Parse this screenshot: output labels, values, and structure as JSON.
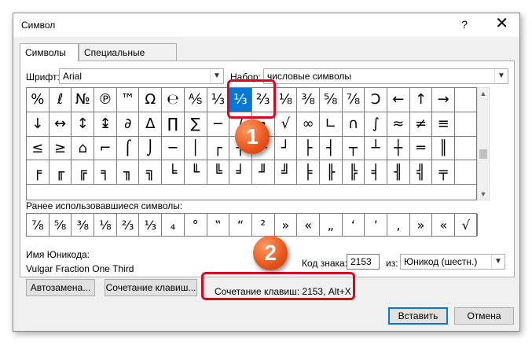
{
  "window": {
    "title": "Символ",
    "help": "?",
    "close": "✕"
  },
  "tabs": [
    {
      "label": "Символы",
      "active": true
    },
    {
      "label": "Специальные знаки",
      "active": false
    }
  ],
  "font": {
    "label": "Шрифт:",
    "value": "Arial"
  },
  "subset": {
    "label": "Набор:",
    "value": "числовые символы"
  },
  "grid": {
    "rows": [
      [
        "%",
        "ℓ",
        "№",
        "℗",
        "™",
        "Ω",
        "℮",
        "⅍",
        "⅓",
        "⅓",
        "⅔",
        "⅛",
        "⅜",
        "⅝",
        "⅞",
        "Ↄ",
        "←",
        "↑",
        "→",
        ""
      ],
      [
        "↓",
        "↔",
        "↕",
        "↨",
        "∂",
        "∆",
        "∏",
        "∑",
        "−",
        "∕",
        "∙",
        "√",
        "∞",
        "∟",
        "∩",
        "∫",
        "≈",
        "≠",
        "≡",
        ""
      ],
      [
        "≤",
        "≥",
        "⌂",
        "⌐",
        "⌠",
        "⌡",
        "─",
        "│",
        "┌",
        "┐",
        "└",
        "┘",
        "├",
        "┤",
        "┬",
        "┴",
        "┼",
        "═",
        "║",
        ""
      ],
      [
        "╒",
        "╓",
        "╔",
        "╕",
        "╖",
        "╗",
        "╘",
        "╙",
        "╚",
        "╛",
        "╜",
        "╝",
        "╞",
        "╟",
        "╠",
        "╡",
        "╢",
        "╣",
        "╤",
        ""
      ]
    ],
    "selected_row": 0,
    "selected_col": 9
  },
  "recent": {
    "label": "Ранее использовавшиеся символы:",
    "items": [
      "⅞",
      "⅝",
      "⅜",
      "⅛",
      "⅔",
      "⅓",
      "₄",
      "°",
      "‟",
      "“",
      "²",
      "»",
      "«",
      "„",
      "‘",
      "’",
      "‚",
      "»",
      "«",
      "√"
    ]
  },
  "unicode_name": {
    "label": "Имя Юникода:",
    "value": "Vulgar Fraction One Third"
  },
  "char_code": {
    "label": "Код знака:",
    "value": "2153"
  },
  "from": {
    "label": "из:",
    "value": "Юникод (шестн.)"
  },
  "buttons": {
    "autocorrect": "Автозамена...",
    "shortcut_key": "Сочетание клавиш...",
    "insert": "Вставить",
    "cancel": "Отмена"
  },
  "shortcut_text": "Сочетание клавиш: 2153, Alt+X",
  "annotations": {
    "badge1": "1",
    "badge2": "2"
  },
  "colors": {
    "selection": "#0078d7",
    "highlight": "#e3001b",
    "badge": "#e8541a"
  }
}
